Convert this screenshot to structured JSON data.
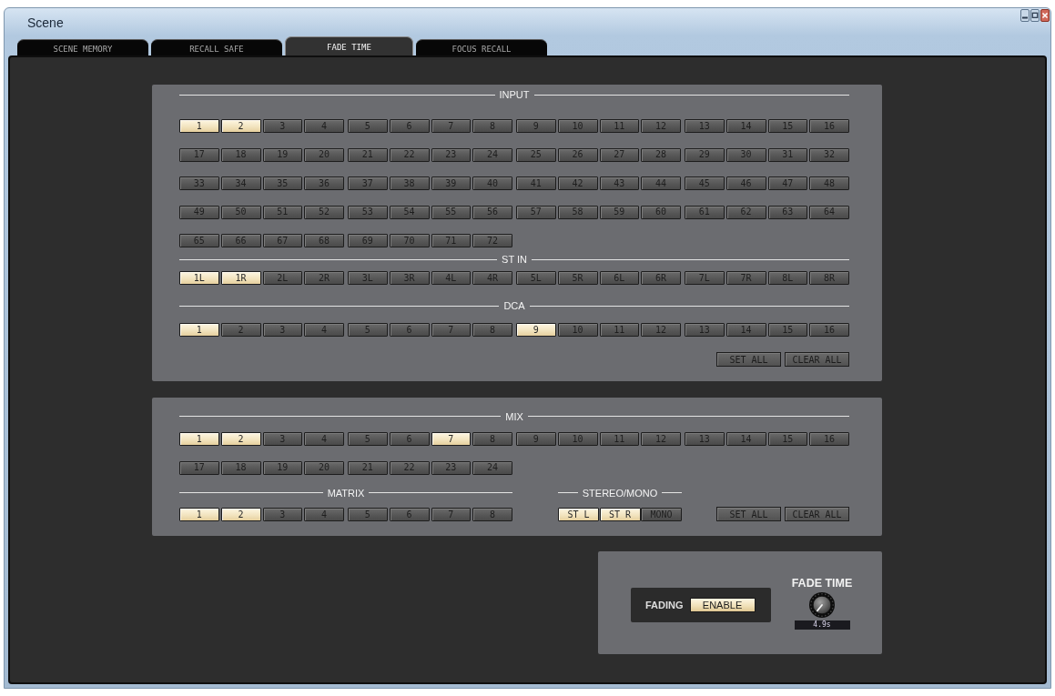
{
  "window": {
    "title": "Scene"
  },
  "tabs": [
    {
      "label": "SCENE MEMORY",
      "selected": false
    },
    {
      "label": "RECALL SAFE",
      "selected": false
    },
    {
      "label": "FADE TIME",
      "selected": true
    },
    {
      "label": "FOCUS RECALL",
      "selected": false
    }
  ],
  "channel_panel": {
    "sections": [
      {
        "title": "INPUT",
        "buttons": [
          {
            "label": "1",
            "on": true
          },
          {
            "label": "2",
            "on": true
          },
          {
            "label": "3",
            "on": false
          },
          {
            "label": "4",
            "on": false
          },
          {
            "label": "5",
            "on": false
          },
          {
            "label": "6",
            "on": false
          },
          {
            "label": "7",
            "on": false
          },
          {
            "label": "8",
            "on": false
          },
          {
            "label": "9",
            "on": false
          },
          {
            "label": "10",
            "on": false
          },
          {
            "label": "11",
            "on": false
          },
          {
            "label": "12",
            "on": false
          },
          {
            "label": "13",
            "on": false
          },
          {
            "label": "14",
            "on": false
          },
          {
            "label": "15",
            "on": false
          },
          {
            "label": "16",
            "on": false
          },
          {
            "label": "17",
            "on": false
          },
          {
            "label": "18",
            "on": false
          },
          {
            "label": "19",
            "on": false
          },
          {
            "label": "20",
            "on": false
          },
          {
            "label": "21",
            "on": false
          },
          {
            "label": "22",
            "on": false
          },
          {
            "label": "23",
            "on": false
          },
          {
            "label": "24",
            "on": false
          },
          {
            "label": "25",
            "on": false
          },
          {
            "label": "26",
            "on": false
          },
          {
            "label": "27",
            "on": false
          },
          {
            "label": "28",
            "on": false
          },
          {
            "label": "29",
            "on": false
          },
          {
            "label": "30",
            "on": false
          },
          {
            "label": "31",
            "on": false
          },
          {
            "label": "32",
            "on": false
          },
          {
            "label": "33",
            "on": false
          },
          {
            "label": "34",
            "on": false
          },
          {
            "label": "35",
            "on": false
          },
          {
            "label": "36",
            "on": false
          },
          {
            "label": "37",
            "on": false
          },
          {
            "label": "38",
            "on": false
          },
          {
            "label": "39",
            "on": false
          },
          {
            "label": "40",
            "on": false
          },
          {
            "label": "41",
            "on": false
          },
          {
            "label": "42",
            "on": false
          },
          {
            "label": "43",
            "on": false
          },
          {
            "label": "44",
            "on": false
          },
          {
            "label": "45",
            "on": false
          },
          {
            "label": "46",
            "on": false
          },
          {
            "label": "47",
            "on": false
          },
          {
            "label": "48",
            "on": false
          },
          {
            "label": "49",
            "on": false
          },
          {
            "label": "50",
            "on": false
          },
          {
            "label": "51",
            "on": false
          },
          {
            "label": "52",
            "on": false
          },
          {
            "label": "53",
            "on": false
          },
          {
            "label": "54",
            "on": false
          },
          {
            "label": "55",
            "on": false
          },
          {
            "label": "56",
            "on": false
          },
          {
            "label": "57",
            "on": false
          },
          {
            "label": "58",
            "on": false
          },
          {
            "label": "59",
            "on": false
          },
          {
            "label": "60",
            "on": false
          },
          {
            "label": "61",
            "on": false
          },
          {
            "label": "62",
            "on": false
          },
          {
            "label": "63",
            "on": false
          },
          {
            "label": "64",
            "on": false
          },
          {
            "label": "65",
            "on": false
          },
          {
            "label": "66",
            "on": false
          },
          {
            "label": "67",
            "on": false
          },
          {
            "label": "68",
            "on": false
          },
          {
            "label": "69",
            "on": false
          },
          {
            "label": "70",
            "on": false
          },
          {
            "label": "71",
            "on": false
          },
          {
            "label": "72",
            "on": false
          }
        ]
      },
      {
        "title": "ST IN",
        "buttons": [
          {
            "label": "1L",
            "on": true
          },
          {
            "label": "1R",
            "on": true
          },
          {
            "label": "2L",
            "on": false
          },
          {
            "label": "2R",
            "on": false
          },
          {
            "label": "3L",
            "on": false
          },
          {
            "label": "3R",
            "on": false
          },
          {
            "label": "4L",
            "on": false
          },
          {
            "label": "4R",
            "on": false
          },
          {
            "label": "5L",
            "on": false
          },
          {
            "label": "5R",
            "on": false
          },
          {
            "label": "6L",
            "on": false
          },
          {
            "label": "6R",
            "on": false
          },
          {
            "label": "7L",
            "on": false
          },
          {
            "label": "7R",
            "on": false
          },
          {
            "label": "8L",
            "on": false
          },
          {
            "label": "8R",
            "on": false
          }
        ]
      },
      {
        "title": "DCA",
        "buttons": [
          {
            "label": "1",
            "on": true
          },
          {
            "label": "2",
            "on": false
          },
          {
            "label": "3",
            "on": false
          },
          {
            "label": "4",
            "on": false
          },
          {
            "label": "5",
            "on": false
          },
          {
            "label": "6",
            "on": false
          },
          {
            "label": "7",
            "on": false
          },
          {
            "label": "8",
            "on": false
          },
          {
            "label": "9",
            "on": true
          },
          {
            "label": "10",
            "on": false
          },
          {
            "label": "11",
            "on": false
          },
          {
            "label": "12",
            "on": false
          },
          {
            "label": "13",
            "on": false
          },
          {
            "label": "14",
            "on": false
          },
          {
            "label": "15",
            "on": false
          },
          {
            "label": "16",
            "on": false
          }
        ]
      }
    ],
    "actions": [
      "SET ALL",
      "CLEAR ALL"
    ]
  },
  "output_panel": {
    "mix": {
      "title": "MIX",
      "buttons": [
        {
          "label": "1",
          "on": true
        },
        {
          "label": "2",
          "on": true
        },
        {
          "label": "3",
          "on": false
        },
        {
          "label": "4",
          "on": false
        },
        {
          "label": "5",
          "on": false
        },
        {
          "label": "6",
          "on": false
        },
        {
          "label": "7",
          "on": true
        },
        {
          "label": "8",
          "on": false
        },
        {
          "label": "9",
          "on": false
        },
        {
          "label": "10",
          "on": false
        },
        {
          "label": "11",
          "on": false
        },
        {
          "label": "12",
          "on": false
        },
        {
          "label": "13",
          "on": false
        },
        {
          "label": "14",
          "on": false
        },
        {
          "label": "15",
          "on": false
        },
        {
          "label": "16",
          "on": false
        },
        {
          "label": "17",
          "on": false
        },
        {
          "label": "18",
          "on": false
        },
        {
          "label": "19",
          "on": false
        },
        {
          "label": "20",
          "on": false
        },
        {
          "label": "21",
          "on": false
        },
        {
          "label": "22",
          "on": false
        },
        {
          "label": "23",
          "on": false
        },
        {
          "label": "24",
          "on": false
        }
      ]
    },
    "matrix": {
      "title": "MATRIX",
      "buttons": [
        {
          "label": "1",
          "on": true
        },
        {
          "label": "2",
          "on": true
        },
        {
          "label": "3",
          "on": false
        },
        {
          "label": "4",
          "on": false
        },
        {
          "label": "5",
          "on": false
        },
        {
          "label": "6",
          "on": false
        },
        {
          "label": "7",
          "on": false
        },
        {
          "label": "8",
          "on": false
        }
      ]
    },
    "stereo_mono": {
      "title": "STEREO/MONO",
      "buttons": [
        {
          "label": "ST L",
          "on": true
        },
        {
          "label": "ST R",
          "on": true
        },
        {
          "label": "MONO",
          "on": false
        }
      ]
    },
    "actions": [
      "SET ALL",
      "CLEAR ALL"
    ]
  },
  "fade_panel": {
    "fading": {
      "label": "FADING",
      "button": {
        "label": "ENABLE",
        "on": true
      }
    },
    "fade_time": {
      "title": "FADE TIME",
      "value": "4.9s"
    }
  }
}
